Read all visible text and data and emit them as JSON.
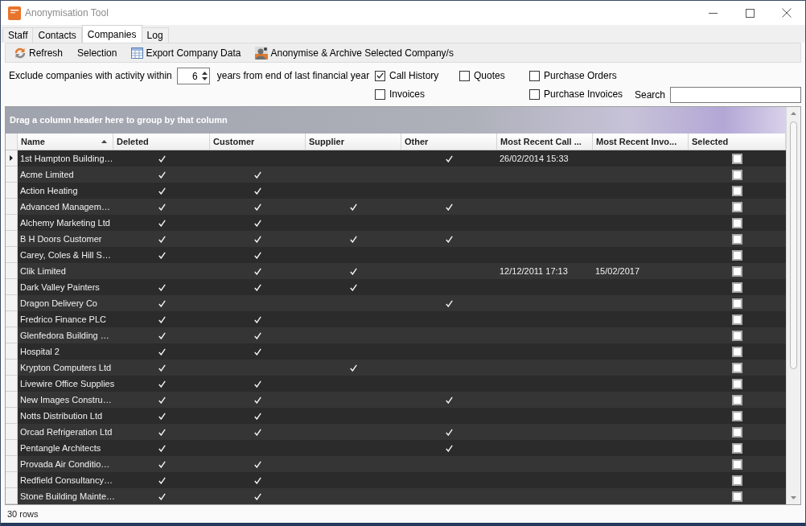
{
  "window": {
    "title": "Anonymisation Tool"
  },
  "tabs": [
    {
      "label": "Staff",
      "selected": false
    },
    {
      "label": "Contacts",
      "selected": false
    },
    {
      "label": "Companies",
      "selected": true
    },
    {
      "label": "Log",
      "selected": false
    }
  ],
  "toolbar": [
    {
      "kind": "refresh",
      "label": "Refresh"
    },
    {
      "kind": "menu",
      "label": "Selection"
    },
    {
      "kind": "export",
      "label": "Export Company Data"
    },
    {
      "kind": "archive",
      "label": "Anonymise & Archive Selected Company/s"
    }
  ],
  "activity_filter": {
    "label": "Exclude companies with activity within",
    "years": "6",
    "unit_label": "years from end of last financial year"
  },
  "activity_types": [
    {
      "items": [
        {
          "label": "Call History",
          "checked": true
        },
        {
          "label": "Invoices",
          "checked": false
        }
      ]
    },
    {
      "items": [
        {
          "label": "Quotes",
          "checked": false
        }
      ]
    },
    {
      "items": [
        {
          "label": "Purchase Orders",
          "checked": false
        },
        {
          "label": "Purchase Invoices",
          "checked": false
        }
      ]
    }
  ],
  "search": {
    "label": "Search"
  },
  "grid": {
    "group_panel_hint": "Drag a column header here to group by that column",
    "columns": [
      {
        "label": "Name",
        "kind": "text",
        "sorted": true
      },
      {
        "label": "Deleted",
        "kind": "tick",
        "sorted": false
      },
      {
        "label": "Customer",
        "kind": "tick",
        "sorted": false
      },
      {
        "label": "Supplier",
        "kind": "tick",
        "sorted": false
      },
      {
        "label": "Other",
        "kind": "tick",
        "sorted": false
      },
      {
        "label": "Most Recent Call ...",
        "kind": "text",
        "sorted": false
      },
      {
        "label": "Most Recent Invo...",
        "kind": "text",
        "sorted": false
      },
      {
        "label": "Selected",
        "kind": "checkbox",
        "sorted": false
      }
    ],
    "rows": [
      {
        "current": true,
        "name": "1st Hampton Building…",
        "deleted": true,
        "customer": false,
        "supplier": false,
        "other": true,
        "most_recent_call": "26/02/2014 15:33",
        "selected": false
      },
      {
        "current": false,
        "name": "Acme Limited",
        "deleted": true,
        "customer": true,
        "supplier": false,
        "other": false,
        "selected": false
      },
      {
        "current": false,
        "name": "Action Heating",
        "deleted": true,
        "customer": true,
        "supplier": false,
        "other": false,
        "selected": false
      },
      {
        "current": false,
        "name": "Advanced Managem…",
        "deleted": true,
        "customer": true,
        "supplier": true,
        "other": true,
        "selected": false
      },
      {
        "current": false,
        "name": "Alchemy Marketing Ltd",
        "deleted": true,
        "customer": true,
        "supplier": false,
        "other": false,
        "selected": false
      },
      {
        "current": false,
        "name": "B H Doors Customer",
        "deleted": true,
        "customer": true,
        "supplier": true,
        "other": true,
        "selected": false
      },
      {
        "current": false,
        "name": "Carey, Coles & Hill S…",
        "deleted": true,
        "customer": true,
        "supplier": false,
        "other": false,
        "selected": false
      },
      {
        "current": false,
        "name": "Clik Limited",
        "deleted": false,
        "customer": true,
        "supplier": true,
        "other": false,
        "most_recent_call": "12/12/2011 17:13",
        "most_recent_invoice": "15/02/2017",
        "selected": false
      },
      {
        "current": false,
        "name": "Dark Valley Painters",
        "deleted": true,
        "customer": true,
        "supplier": true,
        "other": false,
        "selected": false
      },
      {
        "current": false,
        "name": "Dragon Delivery Co",
        "deleted": true,
        "customer": false,
        "supplier": false,
        "other": true,
        "selected": false
      },
      {
        "current": false,
        "name": "Fredrico Finance PLC",
        "deleted": true,
        "customer": true,
        "supplier": false,
        "other": false,
        "selected": false
      },
      {
        "current": false,
        "name": "Glenfedora Building …",
        "deleted": true,
        "customer": true,
        "supplier": false,
        "other": false,
        "selected": false
      },
      {
        "current": false,
        "name": "Hospital 2",
        "deleted": true,
        "customer": true,
        "supplier": false,
        "other": false,
        "selected": false
      },
      {
        "current": false,
        "name": "Krypton Computers Ltd",
        "deleted": true,
        "customer": false,
        "supplier": true,
        "other": false,
        "selected": false
      },
      {
        "current": false,
        "name": "Livewire Office Supplies",
        "deleted": true,
        "customer": true,
        "supplier": false,
        "other": false,
        "selected": false
      },
      {
        "current": false,
        "name": "New Images Constru…",
        "deleted": true,
        "customer": true,
        "supplier": false,
        "other": true,
        "selected": false
      },
      {
        "current": false,
        "name": "Notts Distribution Ltd",
        "deleted": true,
        "customer": true,
        "supplier": false,
        "other": false,
        "selected": false
      },
      {
        "current": false,
        "name": "Orcad Refrigeration Ltd",
        "deleted": true,
        "customer": true,
        "supplier": false,
        "other": true,
        "selected": false
      },
      {
        "current": false,
        "name": "Pentangle Architects",
        "deleted": true,
        "customer": false,
        "supplier": false,
        "other": true,
        "selected": false
      },
      {
        "current": false,
        "name": "Provada Air Conditio…",
        "deleted": true,
        "customer": true,
        "supplier": false,
        "other": false,
        "selected": false
      },
      {
        "current": false,
        "name": "Redfield Consultancy…",
        "deleted": true,
        "customer": true,
        "supplier": false,
        "other": false,
        "selected": false
      },
      {
        "current": false,
        "name": "Stone Building Mainte…",
        "deleted": true,
        "customer": true,
        "supplier": false,
        "other": false,
        "selected": false
      }
    ]
  },
  "status_bar": {
    "text": "30 rows"
  }
}
